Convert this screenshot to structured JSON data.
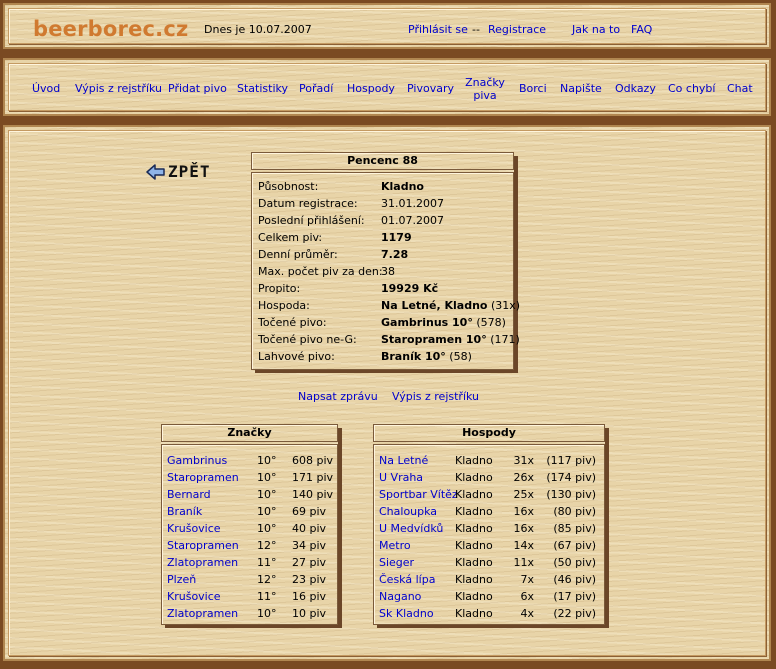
{
  "header": {
    "logo": "beerborec.cz",
    "date": "Dnes je 10.07.2007",
    "login": "Přihlásit se",
    "separator": "--",
    "register": "Registrace",
    "howto": "Jak na to",
    "faq": "FAQ"
  },
  "nav": [
    {
      "label": "Úvod"
    },
    {
      "label": "Výpis z rejstříku"
    },
    {
      "label": "Přidat pivo"
    },
    {
      "label": "Statistiky"
    },
    {
      "label": "Pořadí"
    },
    {
      "label": "Hospody"
    },
    {
      "label": "Pivovary"
    },
    {
      "label": "Značky piva"
    },
    {
      "label": "Borci"
    },
    {
      "label": "Napište"
    },
    {
      "label": "Odkazy"
    },
    {
      "label": "Co chybí"
    },
    {
      "label": "Chat"
    }
  ],
  "back": {
    "label": "ZPĚT"
  },
  "profile": {
    "title": "Pencenc 88",
    "rows": [
      {
        "label": "Působnost:",
        "value": "Kladno",
        "extra": ""
      },
      {
        "label": "Datum registrace:",
        "value": "31.01.2007",
        "extra": ""
      },
      {
        "label": "Poslední přihlášení:",
        "value": "01.07.2007",
        "extra": ""
      },
      {
        "label": "Celkem piv:",
        "value": "1179",
        "extra": ""
      },
      {
        "label": "Denní průměr:",
        "value": "7.28",
        "extra": ""
      },
      {
        "label": "Max. počet piv za den:",
        "value": "38",
        "extra": ""
      },
      {
        "label": "Propito:",
        "value": "19929 Kč",
        "extra": ""
      },
      {
        "label": "Hospoda:",
        "value": "Na Letné, Kladno",
        "extra": "(31x)"
      },
      {
        "label": "Točené pivo:",
        "value": "Gambrinus 10°",
        "extra": "(578)"
      },
      {
        "label": "Točené pivo ne-G:",
        "value": "Staropramen 10°",
        "extra": "(171)"
      },
      {
        "label": "Lahvové pivo:",
        "value": "Braník 10°",
        "extra": "(58)"
      }
    ]
  },
  "actions": {
    "message": "Napsat zprávu",
    "registry": "Výpis z rejstříku"
  },
  "brands": {
    "title": "Značky",
    "rows": [
      {
        "name": "Gambrinus",
        "degree": "10°",
        "count": "608 piv"
      },
      {
        "name": "Staropramen",
        "degree": "10°",
        "count": "171 piv"
      },
      {
        "name": "Bernard",
        "degree": "10°",
        "count": "140 piv"
      },
      {
        "name": "Braník",
        "degree": "10°",
        "count": "69 piv"
      },
      {
        "name": "Krušovice",
        "degree": "10°",
        "count": "40 piv"
      },
      {
        "name": "Staropramen",
        "degree": "12°",
        "count": "34 piv"
      },
      {
        "name": "Zlatopramen",
        "degree": "11°",
        "count": "27 piv"
      },
      {
        "name": "Plzeň",
        "degree": "12°",
        "count": "23 piv"
      },
      {
        "name": "Krušovice",
        "degree": "11°",
        "count": "16 piv"
      },
      {
        "name": "Zlatopramen",
        "degree": "10°",
        "count": "10 piv"
      }
    ]
  },
  "pubs": {
    "title": "Hospody",
    "rows": [
      {
        "name": "Na Letné",
        "city": "Kladno",
        "visits": "31x",
        "beers": "(117 piv)"
      },
      {
        "name": "U Vraha",
        "city": "Kladno",
        "visits": "26x",
        "beers": "(174 piv)"
      },
      {
        "name": "Sportbar Vítěz",
        "city": "Kladno",
        "visits": "25x",
        "beers": "(130 piv)"
      },
      {
        "name": "Chaloupka",
        "city": "Kladno",
        "visits": "16x",
        "beers": "(80 piv)"
      },
      {
        "name": "U Medvídků",
        "city": "Kladno",
        "visits": "16x",
        "beers": "(85 piv)"
      },
      {
        "name": "Metro",
        "city": "Kladno",
        "visits": "14x",
        "beers": "(67 piv)"
      },
      {
        "name": "Sieger",
        "city": "Kladno",
        "visits": "11x",
        "beers": "(50 piv)"
      },
      {
        "name": "Česká lípa",
        "city": "Kladno",
        "visits": "7x",
        "beers": "(46 piv)"
      },
      {
        "name": "Nagano",
        "city": "Kladno",
        "visits": "6x",
        "beers": "(17 piv)"
      },
      {
        "name": "Sk Kladno",
        "city": "Kladno",
        "visits": "4x",
        "beers": "(22 piv)"
      }
    ]
  },
  "colors": {
    "logo": "#d07a30",
    "link": "#0000cc",
    "frame": "#7a4a22"
  }
}
